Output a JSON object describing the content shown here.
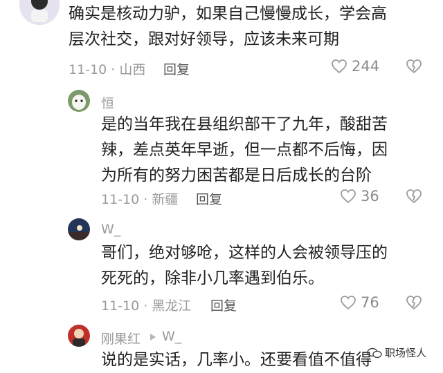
{
  "comments": [
    {
      "text_lines": [
        "确实是核动力驴，如果自己慢慢成长，学会高",
        "层次社交，跟对好领导，应该未来可期"
      ],
      "meta": "11-10 · 山西",
      "reply_label": "回复",
      "likes": "244"
    },
    {
      "username": "恒",
      "text_lines": [
        "是的当年我在县组织部干了九年，酸甜苦",
        "辣，差点英年早逝，但一点都不后悔，因",
        "为所有的努力困苦都是日后成长的台阶"
      ],
      "meta": "11-10 · 新疆",
      "reply_label": "回复",
      "likes": "36"
    },
    {
      "username": "W_",
      "text_lines": [
        "哥们，绝对够呛，这样的人会被领导压的",
        "死死的，除非小几率遇到伯乐。"
      ],
      "meta": "11-10 · 黑龙江",
      "reply_label": "回复",
      "likes": "76"
    },
    {
      "username": "刚果红",
      "reply_to": "W_",
      "text_lines": [
        "说的是实话，几率小。还要看值不值得"
      ]
    }
  ],
  "watermark": "职场怪人",
  "colors": {
    "meta": "#9a9a9a",
    "text": "#222222",
    "icon": "#9a9a9a"
  }
}
